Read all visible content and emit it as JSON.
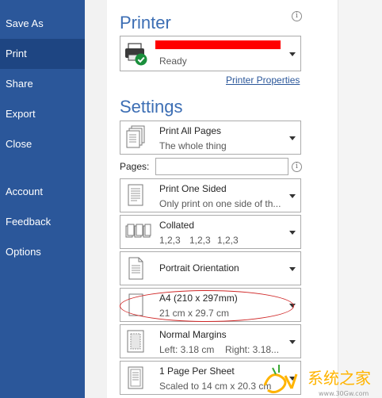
{
  "sidebar": {
    "items": [
      {
        "label": "Save As",
        "active": false
      },
      {
        "label": "Print",
        "active": true
      },
      {
        "label": "Share",
        "active": false
      },
      {
        "label": "Export",
        "active": false
      },
      {
        "label": "Close",
        "active": false
      },
      {
        "label": "Account",
        "active": false
      },
      {
        "label": "Feedback",
        "active": false
      },
      {
        "label": "Options",
        "active": false
      }
    ]
  },
  "printer": {
    "heading": "Printer",
    "name": "",
    "status": "Ready",
    "properties_link": "Printer Properties",
    "icon": "printer-ready-icon"
  },
  "settings": {
    "heading": "Settings",
    "print_what": {
      "title": "Print All Pages",
      "subtitle": "The whole thing",
      "icon": "pages-icon"
    },
    "pages": {
      "label": "Pages:",
      "value": "",
      "placeholder": ""
    },
    "sides": {
      "title": "Print One Sided",
      "subtitle": "Only print on one side of th...",
      "icon": "one-sided-icon"
    },
    "collation": {
      "title": "Collated",
      "subtitle": [
        "1,2,3",
        "1,2,3",
        "1,2,3"
      ],
      "icon": "collated-icon"
    },
    "orientation": {
      "title": "Portrait Orientation",
      "icon": "portrait-icon"
    },
    "paper": {
      "title": "A4 (210 x 297mm)",
      "subtitle": "21 cm x 29.7 cm",
      "icon": "paper-size-icon"
    },
    "margins": {
      "title": "Normal Margins",
      "left": "Left:  3.18 cm",
      "right": "Right:  3.18...",
      "icon": "margins-icon"
    },
    "per_sheet": {
      "title": "1 Page Per Sheet",
      "subtitle": "Scaled to 14 cm x 20.3 cm",
      "icon": "pages-per-sheet-icon"
    }
  },
  "watermark": {
    "text": "系统之家",
    "domain": "www.30Gw.com",
    "color": "#ffb400"
  },
  "colors": {
    "accent": "#2b579a",
    "active_nav": "#1e4582",
    "heading": "#3c6eb4",
    "annotation": "#d02828",
    "redaction": "#ff0000"
  }
}
